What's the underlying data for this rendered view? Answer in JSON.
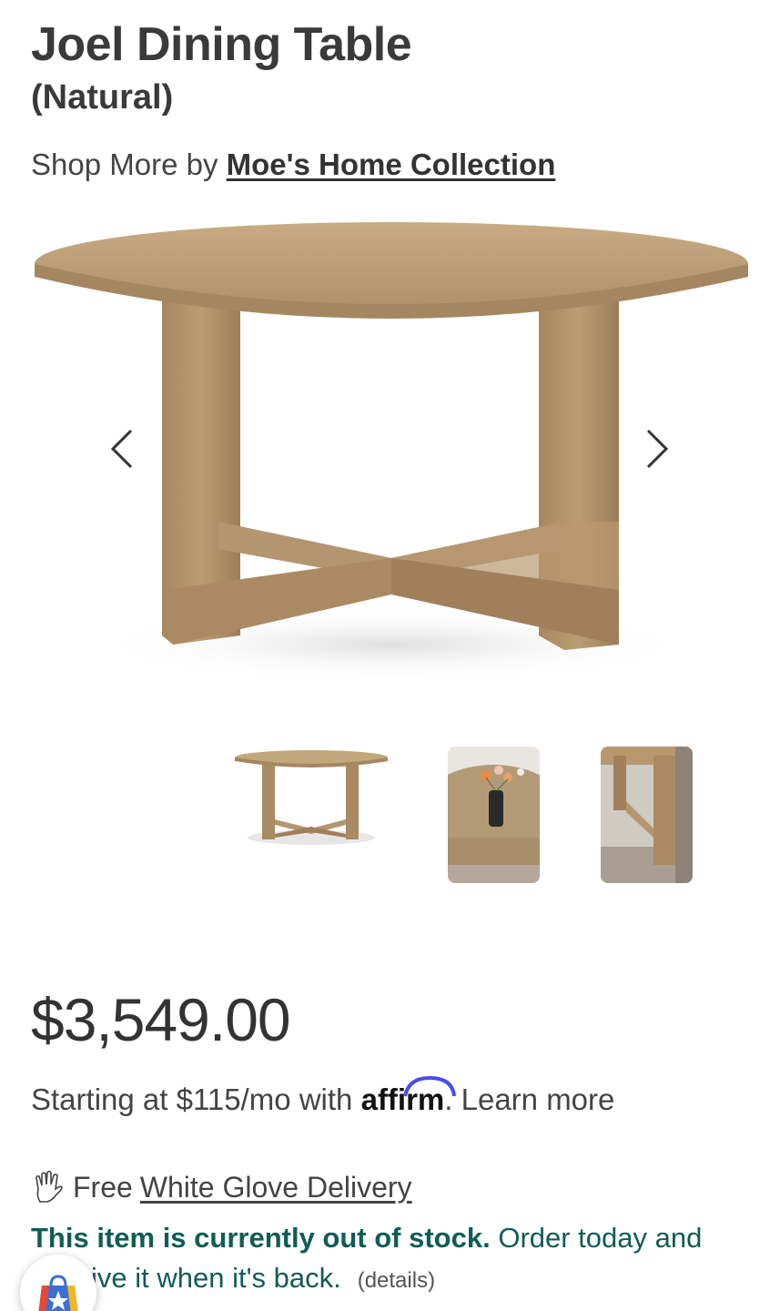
{
  "product": {
    "title": "Joel Dining Table",
    "variant": "(Natural)"
  },
  "brand": {
    "prefix": "Shop More by ",
    "name": "Moe's Home Collection"
  },
  "gallery": {
    "prev_icon": "chevron-left-icon",
    "next_icon": "chevron-right-icon",
    "thumbnail_count": 3
  },
  "pricing": {
    "price": "$3,549.00",
    "financing_prefix": "Starting at $115/mo with ",
    "financing_brand": "affirm",
    "financing_suffix": ".",
    "learn_more": " Learn more"
  },
  "delivery": {
    "icon": "glove-icon",
    "prefix": "Free",
    "link": "White Glove Delivery"
  },
  "stock": {
    "status": "This item is currently out of stock.",
    "message": " Order today and ",
    "message_visible_tail": "ive it when it's back.",
    "details": "(details)"
  },
  "colors": {
    "text": "#333333",
    "stock_green": "#0f5d55",
    "affirm_blue": "#4a4af4",
    "wood": "#b89a72"
  }
}
